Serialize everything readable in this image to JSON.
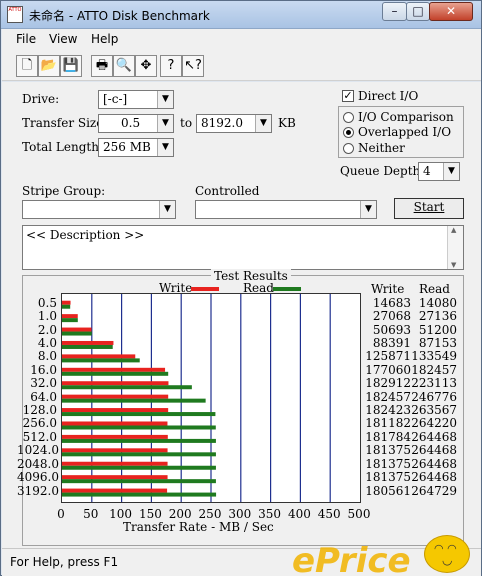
{
  "window": {
    "title": "未命名 - ATTO Disk Benchmark",
    "app_icon_text": "ATTO",
    "min_glyph": "–",
    "max_glyph": "□",
    "close_glyph": "✕"
  },
  "menu": [
    "File",
    "View",
    "Help"
  ],
  "toolbar": [
    {
      "name": "new-document-icon",
      "glyph": "🗋"
    },
    {
      "name": "open-folder-icon",
      "glyph": "📂"
    },
    {
      "name": "save-icon",
      "glyph": "💾"
    },
    {
      "name": "print-icon",
      "glyph": "🖶"
    },
    {
      "name": "print-preview-icon",
      "glyph": "🔍"
    },
    {
      "name": "move-icon",
      "glyph": "✥"
    },
    {
      "name": "help-icon",
      "glyph": "?"
    },
    {
      "name": "context-help-icon",
      "glyph": "↖?"
    }
  ],
  "form": {
    "drive_label": "Drive:",
    "drive_value": "[-c-]",
    "transfer_size_label": "Transfer Size:",
    "transfer_from": "0.5",
    "to_label": "to",
    "transfer_to": "8192.0",
    "kb_label": "KB",
    "total_length_label": "Total Length:",
    "total_length_value": "256 MB",
    "direct_io_label": "Direct I/O",
    "direct_io_checked": "✓",
    "io_comparison_label": "I/O Comparison",
    "overlapped_io_label": "Overlapped I/O",
    "neither_label": "Neither",
    "queue_depth_label": "Queue Depth:",
    "queue_depth_value": "4",
    "stripe_group_label": "Stripe Group:",
    "controlled_label": "Controlled",
    "start_label": "Start",
    "description_text": "<< Description >>"
  },
  "results": {
    "title": "Test Results",
    "write_legend": "Write",
    "read_legend": "Read",
    "write_col": "Write",
    "read_col": "Read",
    "x_title": "Transfer Rate - MB / Sec"
  },
  "chart_data": {
    "type": "bar",
    "orientation": "horizontal",
    "title": "Test Results",
    "xlabel": "Transfer Rate - MB / Sec",
    "xlim": [
      0,
      500
    ],
    "xticks": [
      "0",
      "50",
      "100",
      "150",
      "200",
      "250",
      "300",
      "350",
      "400",
      "450",
      "500"
    ],
    "grid": true,
    "legend": "top",
    "categories": [
      "0.5",
      "1.0",
      "2.0",
      "4.0",
      "8.0",
      "16.0",
      "32.0",
      "64.0",
      "128.0",
      "256.0",
      "512.0",
      "1024.0",
      "2048.0",
      "4096.0",
      "3192.0"
    ],
    "series": [
      {
        "name": "Write",
        "color": "#e8231f",
        "values": [
          14683,
          27068,
          50693,
          88391,
          125871,
          177060,
          182912,
          182457,
          182423,
          181182,
          181784,
          181375,
          181375,
          181375,
          180561
        ]
      },
      {
        "name": "Read",
        "color": "#1f7a1f",
        "values": [
          14080,
          27136,
          51200,
          87153,
          133549,
          182457,
          223113,
          246776,
          263567,
          264220,
          264468,
          264468,
          264468,
          264468,
          264729
        ]
      }
    ]
  },
  "status": {
    "text": "For Help, press F1",
    "watermark": "ePrice"
  }
}
